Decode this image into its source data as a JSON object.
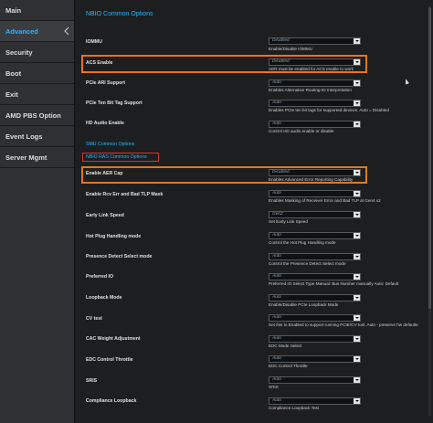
{
  "sidebar": {
    "items": [
      {
        "label": "Main"
      },
      {
        "label": "Advanced"
      },
      {
        "label": "Security"
      },
      {
        "label": "Boot"
      },
      {
        "label": "Exit"
      },
      {
        "label": "AMD PBS Option"
      },
      {
        "label": "Event Logs"
      },
      {
        "label": "Server Mgmt"
      }
    ]
  },
  "main": {
    "title": "NBIO Common Options",
    "smu_link": "SMU Common Options",
    "ras_link": "NBIO RAS Common Options",
    "settings": [
      {
        "label": "IOMMU",
        "value": "Disabled",
        "help": "Enable/Disable IOMMU"
      },
      {
        "label": "ACS Enable",
        "value": "Disabled",
        "help": "AER must be enabled for ACS enable to work"
      },
      {
        "label": "PCIe ARI Support",
        "value": "Auto",
        "help": "Enables Alternative Routing-ID Interpretation"
      },
      {
        "label": "PCIe Ten Bit Tag Support",
        "value": "Auto",
        "help": "Enables PCIe ten bit tags for supported devices. Auto = Disabled"
      },
      {
        "label": "HD Audio Enable",
        "value": "Auto",
        "help": "Control HD audio enable or disable"
      },
      {
        "label": "Enable AER Cap",
        "value": "Disabled",
        "help": "Enables Advanced Error Reporting Capability"
      },
      {
        "label": "Enable Rcv Err and Bad TLP Mask",
        "value": "Auto",
        "help": "Enables Masking of Receiver Error and Bad TLP at Gen4 x2"
      },
      {
        "label": "Early Link Speed",
        "value": "Gen2",
        "help": "Set Early Link Speed"
      },
      {
        "label": "Hot Plug Handling mode",
        "value": "Auto",
        "help": "Control the Hot Plug Handling mode"
      },
      {
        "label": "Presence Detect Select mode",
        "value": "Auto",
        "help": "Control the Presence Detect Select mode"
      },
      {
        "label": "Preferred IO",
        "value": "Auto",
        "help": "Preferred IO Select Type Manual: Bus Number manually Auto: Default"
      },
      {
        "label": "Loopback Mode",
        "value": "Auto",
        "help": "Enable/Disable PCIe Loopback Mode"
      },
      {
        "label": "CV test",
        "value": "Auto",
        "help": "Set this to Enabled to support running PCIE/CV tool. Auto - preserve hw defaults"
      },
      {
        "label": "CAC Weight Adjustment",
        "value": "Auto",
        "help": "EDC Mode Select"
      },
      {
        "label": "EDC Control Throttle",
        "value": "Auto",
        "help": "EDC Control Throttle"
      },
      {
        "label": "SRIS",
        "value": "Auto",
        "help": "SRIS"
      },
      {
        "label": "Compliance Loopback",
        "value": "Auto",
        "help": "Compliance Loopback Test"
      }
    ]
  },
  "colors": {
    "accent": "#29b6ff",
    "highlight": "#e8751a",
    "highlight_red": "#d9322b",
    "sidebar_bg": "#2e3033",
    "main_bg": "#1d1e20"
  }
}
